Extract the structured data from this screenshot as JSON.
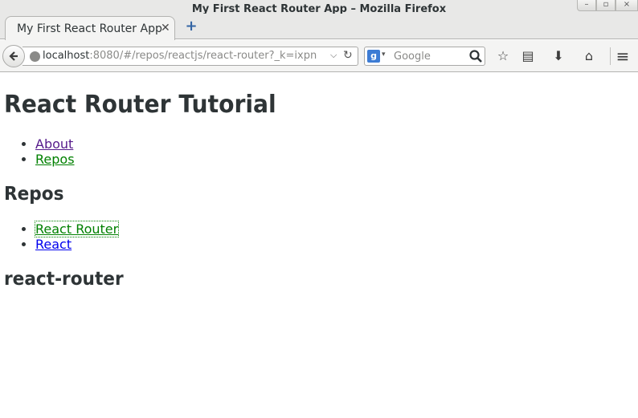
{
  "window": {
    "title": "My First React Router App – Mozilla Firefox",
    "controls": {
      "minimize": "–",
      "maximize": "▫",
      "close": "×"
    }
  },
  "tabs": [
    {
      "label": "My First React Router App",
      "close": "✕"
    }
  ],
  "new_tab": "+",
  "toolbar": {
    "url_host": "localhost",
    "url_rest": ":8080/#/repos/reactjs/react-router?_k=ixpn",
    "url_dropdown": "⌵",
    "url_reload": "↻",
    "search_engine": "g",
    "search_dropdown": "▾",
    "search_placeholder": "Google",
    "icons": [
      "bookmark-star-icon",
      "reading-list-icon",
      "downloads-icon",
      "home-icon",
      "menu-icon"
    ],
    "icon_glyphs": {
      "bookmark": "☆",
      "reading": "▤",
      "downloads": "⬇",
      "home": "⌂",
      "menu": "≡"
    }
  },
  "page": {
    "heading": "React Router Tutorial",
    "nav_links": [
      {
        "label": "About",
        "state": "visited"
      },
      {
        "label": "Repos",
        "state": "active"
      }
    ],
    "repos_heading": "Repos",
    "repo_links": [
      {
        "label": "React Router",
        "state": "active-focused"
      },
      {
        "label": "React",
        "state": "unvisited"
      }
    ],
    "repo_name": "react-router"
  },
  "colors": {
    "visited_link": "#551a8b",
    "active_link": "#008000",
    "unvisited_link": "#0000ee",
    "text": "#2e3436"
  }
}
